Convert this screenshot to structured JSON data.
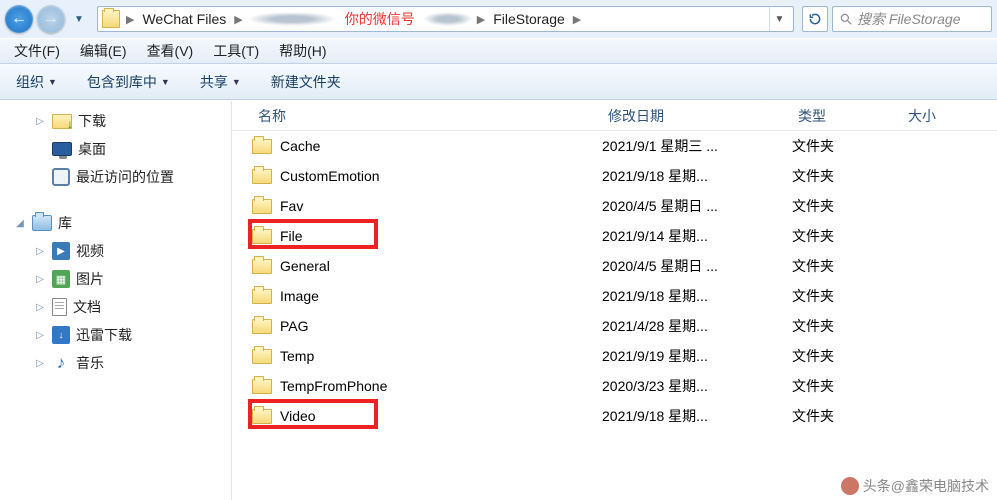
{
  "nav": {
    "back": "←",
    "forward": "→"
  },
  "breadcrumb": {
    "items": [
      "WeChat Files",
      "你的微信号",
      "FileStorage"
    ],
    "redIndex": 1
  },
  "search": {
    "placeholder": "搜索 FileStorage"
  },
  "menubar": [
    "文件(F)",
    "编辑(E)",
    "查看(V)",
    "工具(T)",
    "帮助(H)"
  ],
  "toolbar": {
    "organize": "组织",
    "include": "包含到库中",
    "share": "共享",
    "newfolder": "新建文件夹"
  },
  "sidebar": {
    "downloads": "下载",
    "desktop": "桌面",
    "recent": "最近访问的位置",
    "libraries": "库",
    "videos": "视频",
    "pictures": "图片",
    "documents": "文档",
    "xunlei": "迅雷下载",
    "music": "音乐"
  },
  "columns": {
    "name": "名称",
    "date": "修改日期",
    "type": "类型",
    "size": "大小"
  },
  "typeFolder": "文件夹",
  "rows": [
    {
      "name": "Cache",
      "date": "2021/9/1 星期三 ...",
      "hl": false
    },
    {
      "name": "CustomEmotion",
      "date": "2021/9/18 星期...",
      "hl": false
    },
    {
      "name": "Fav",
      "date": "2020/4/5 星期日 ...",
      "hl": false
    },
    {
      "name": "File",
      "date": "2021/9/14 星期...",
      "hl": true
    },
    {
      "name": "General",
      "date": "2020/4/5 星期日 ...",
      "hl": false
    },
    {
      "name": "Image",
      "date": "2021/9/18 星期...",
      "hl": false
    },
    {
      "name": "PAG",
      "date": "2021/4/28 星期...",
      "hl": false
    },
    {
      "name": "Temp",
      "date": "2021/9/19 星期...",
      "hl": false
    },
    {
      "name": "TempFromPhone",
      "date": "2020/3/23 星期...",
      "hl": false
    },
    {
      "name": "Video",
      "date": "2021/9/18 星期...",
      "hl": true
    }
  ],
  "watermark": "头条@鑫荣电脑技术"
}
